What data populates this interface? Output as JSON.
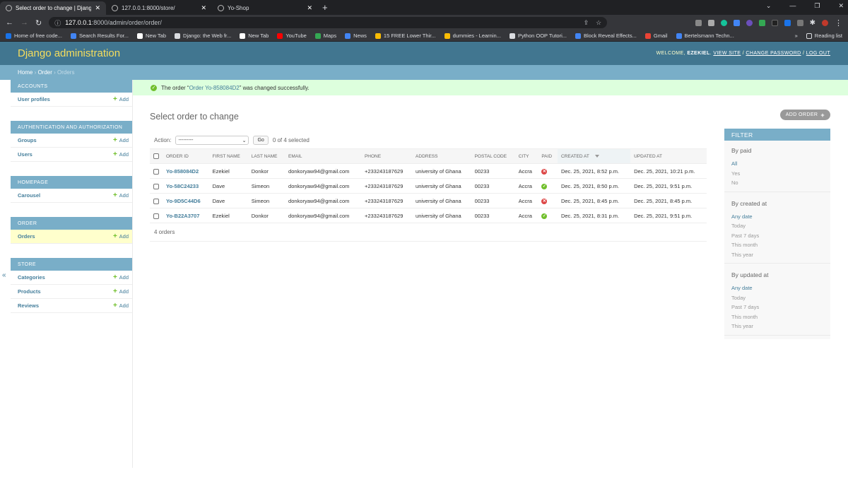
{
  "browser": {
    "tabs": [
      {
        "title": "Select order to change | Django"
      },
      {
        "title": "127.0.0.1:8000/store/"
      },
      {
        "title": "Yo-Shop"
      }
    ],
    "url_host": "127.0.0.1",
    "url_path": ":8000/admin/order/order/",
    "bookmarks": [
      {
        "label": "Home of free code...",
        "color": "#1a73e8"
      },
      {
        "label": "Search Results For...",
        "color": "#4285f4"
      },
      {
        "label": "New Tab",
        "color": "#ffffff"
      },
      {
        "label": "Django: the Web fr...",
        "color": "#dadce0"
      },
      {
        "label": "New Tab",
        "color": "#ffffff"
      },
      {
        "label": "YouTube",
        "color": "#ff0000"
      },
      {
        "label": "Maps",
        "color": "#34a853"
      },
      {
        "label": "News",
        "color": "#4285f4"
      },
      {
        "label": "15 FREE Lower Thir...",
        "color": "#fbbc04"
      },
      {
        "label": "dummies - Learnin...",
        "color": "#fbbc04"
      },
      {
        "label": "Python OOP Tutori...",
        "color": "#dadce0"
      },
      {
        "label": "Block Reveal Effects...",
        "color": "#4285f4"
      },
      {
        "label": "Gmail",
        "color": "#ea4335"
      },
      {
        "label": "Bertelsmann Techn...",
        "color": "#4285f4"
      }
    ],
    "reading_list": "Reading list"
  },
  "header": {
    "brand": "Django administration",
    "welcome": "Welcome,",
    "username": "Ezekiel",
    "view_site": "View site",
    "change_password": "Change password",
    "log_out": "Log out"
  },
  "breadcrumbs": {
    "home": "Home",
    "app": "Order",
    "current": "Orders"
  },
  "sidebar": {
    "modules": [
      {
        "caption": "Accounts",
        "models": [
          {
            "name": "User profiles",
            "current": false
          }
        ]
      },
      {
        "caption": "Authentication and Authorization",
        "models": [
          {
            "name": "Groups",
            "current": false
          },
          {
            "name": "Users",
            "current": false
          }
        ]
      },
      {
        "caption": "Homepage",
        "models": [
          {
            "name": "Carousel",
            "current": false
          }
        ]
      },
      {
        "caption": "Order",
        "models": [
          {
            "name": "Orders",
            "current": true
          }
        ]
      },
      {
        "caption": "Store",
        "models": [
          {
            "name": "Categories",
            "current": false
          },
          {
            "name": "Products",
            "current": false
          },
          {
            "name": "Reviews",
            "current": false
          }
        ]
      }
    ],
    "add_label": "Add",
    "collapse": "«"
  },
  "message": {
    "prefix": "The order “",
    "link": "Order Yo-858084D2",
    "suffix": "” was changed successfully."
  },
  "page_title": "Select order to change",
  "add_button": "ADD ORDER",
  "actions": {
    "label": "Action:",
    "selected_option": "---------",
    "go": "Go",
    "counter": "0 of 4 selected"
  },
  "table": {
    "headers": [
      "Order ID",
      "First name",
      "Last name",
      "Email",
      "Phone",
      "Address",
      "Postal code",
      "City",
      "Paid",
      "Created at",
      "Updated at"
    ],
    "rows": [
      {
        "order_id": "Yo-858084D2",
        "first": "Ezekiel",
        "last": "Donkor",
        "email": "donkoryaw94@gmail.com",
        "phone": "+233243187629",
        "address": "university of Ghana",
        "postal": "00233",
        "city": "Accra",
        "paid": false,
        "created": "Dec. 25, 2021, 8:52 p.m.",
        "updated": "Dec. 25, 2021, 10:21 p.m."
      },
      {
        "order_id": "Yo-58C24233",
        "first": "Dave",
        "last": "Simeon",
        "email": "donkoryaw94@gmail.com",
        "phone": "+233243187629",
        "address": "university of Ghana",
        "postal": "00233",
        "city": "Accra",
        "paid": true,
        "created": "Dec. 25, 2021, 8:50 p.m.",
        "updated": "Dec. 25, 2021, 9:51 p.m."
      },
      {
        "order_id": "Yo-9D5C44D6",
        "first": "Dave",
        "last": "Simeon",
        "email": "donkoryaw94@gmail.com",
        "phone": "+233243187629",
        "address": "university of Ghana",
        "postal": "00233",
        "city": "Accra",
        "paid": false,
        "created": "Dec. 25, 2021, 8:45 p.m.",
        "updated": "Dec. 25, 2021, 8:45 p.m."
      },
      {
        "order_id": "Yo-B22A3707",
        "first": "Ezekiel",
        "last": "Donkor",
        "email": "donkoryaw94@gmail.com",
        "phone": "+233243187629",
        "address": "university of Ghana",
        "postal": "00233",
        "city": "Accra",
        "paid": true,
        "created": "Dec. 25, 2021, 8:31 p.m.",
        "updated": "Dec. 25, 2021, 9:51 p.m."
      }
    ],
    "result_count": "4 orders"
  },
  "filter": {
    "title": "FILTER",
    "groups": [
      {
        "title": "By paid",
        "options": [
          "All",
          "Yes",
          "No"
        ],
        "selected": 0
      },
      {
        "title": "By created at",
        "options": [
          "Any date",
          "Today",
          "Past 7 days",
          "This month",
          "This year"
        ],
        "selected": 0
      },
      {
        "title": "By updated at",
        "options": [
          "Any date",
          "Today",
          "Past 7 days",
          "This month",
          "This year"
        ],
        "selected": 0
      }
    ]
  },
  "colors": {
    "header": "#417690",
    "brand": "#f5dd5d",
    "breadcrumb": "#79aec8",
    "link": "#447e9b",
    "success_bg": "#dddddd",
    "yes": "#70bf2b",
    "no": "#dd4646"
  }
}
